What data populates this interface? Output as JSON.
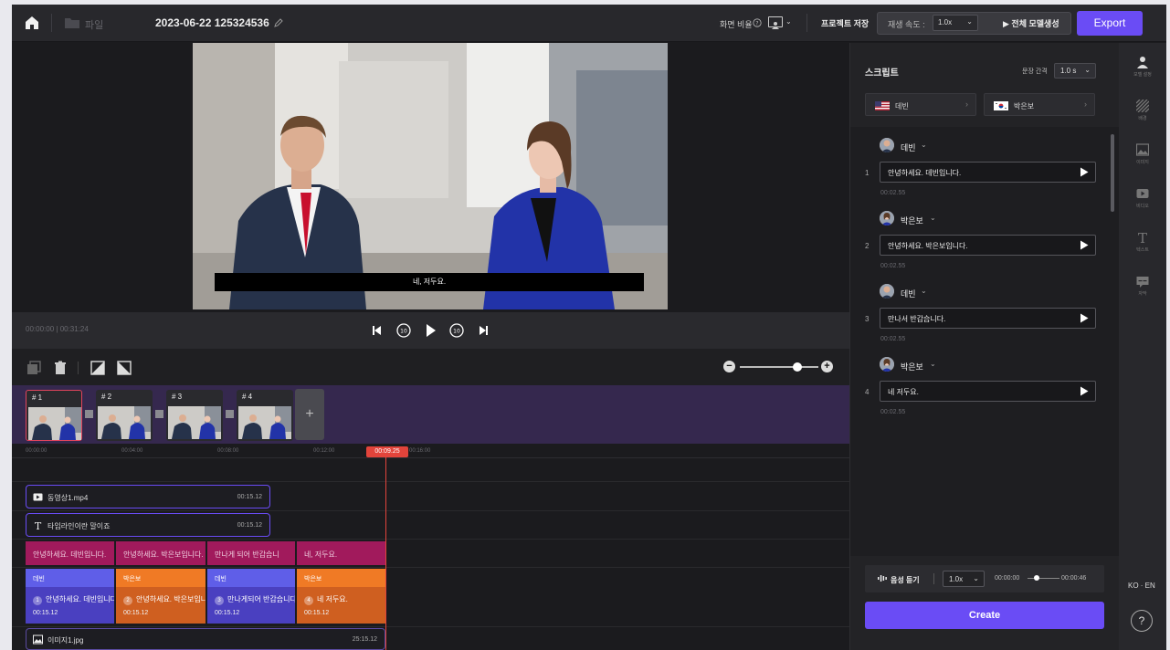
{
  "topbar": {
    "file_label": "파일",
    "project_title": "2023-06-22 125324536",
    "ratio_label": "화면 비율",
    "save_label": "프로젝트 저장",
    "speed_label": "재생 속도 :",
    "speed_value": "1.0x",
    "generate_all": "▶ 전체 모델생성",
    "export_label": "Export"
  },
  "preview": {
    "subtitle": "네, 저두요."
  },
  "playback": {
    "current_time": "00:00:00",
    "divider": "|",
    "total_time": "00:31:24"
  },
  "scenes": [
    {
      "label": "# 1"
    },
    {
      "label": "# 2"
    },
    {
      "label": "# 3"
    },
    {
      "label": "# 4"
    }
  ],
  "scene_add_label": "+",
  "ruler": {
    "ticks": [
      "00:00:00",
      "00:04:00",
      "00:08:00",
      "00:12:00",
      "00:16:00"
    ],
    "playhead": "00:09.25"
  },
  "tracks": {
    "video_clip": {
      "name": "동영상1.mp4",
      "duration": "00:15.12"
    },
    "text_clip": {
      "name": "타임라인이란 말이죠",
      "duration": "00:15.12"
    },
    "subtitles": [
      "안녕하세요. 데빈입니다.",
      "안녕하세요. 박은보입니다.",
      "만나게 되어 반갑습니",
      "네, 저두요."
    ],
    "speakers": [
      {
        "name": "데빈",
        "num": "1",
        "text": "안녕하세요. 데빈입니다.",
        "duration": "00:15.12"
      },
      {
        "name": "박은보",
        "num": "2",
        "text": "안녕하세요. 박은보입니다.",
        "duration": "00:15.12"
      },
      {
        "name": "데빈",
        "num": "3",
        "text": "만나게되어 반갑습니다.",
        "duration": "00:15.12"
      },
      {
        "name": "박은보",
        "num": "4",
        "text": "네 저두요.",
        "duration": "00:15.12"
      }
    ],
    "image_clip": {
      "name": "이미지1.jpg",
      "duration": "25:15.12"
    }
  },
  "script_panel": {
    "title": "스크립트",
    "gap_label": "문장 간격",
    "gap_value": "1.0 s",
    "speaker_tabs": [
      {
        "name": "데빈",
        "flag": "us"
      },
      {
        "name": "박은보",
        "flag": "kr"
      }
    ],
    "tab_arrow": "›",
    "entries": [
      {
        "index": "1",
        "speaker": "데빈",
        "text": "안녕하세요. 데빈입니다.",
        "time": "00:02.55"
      },
      {
        "index": "2",
        "speaker": "박은보",
        "text": "안녕하세요. 박은보입니다.",
        "time": "00:02.55"
      },
      {
        "index": "3",
        "speaker": "데빈",
        "text": "만나서 반갑습니다.",
        "time": "00:02.55"
      },
      {
        "index": "4",
        "speaker": "박은보",
        "text": "네 저두요.",
        "time": "00:02.55"
      }
    ],
    "audio_label": "음성 듣기",
    "audio_speed": "1.0x",
    "audio_start": "00:00:00",
    "audio_end": "00:00:46",
    "create_label": "Create"
  },
  "sidebar": {
    "items": [
      {
        "label": "모델 설정",
        "icon": "person-icon"
      },
      {
        "label": "배경",
        "icon": "background-icon"
      },
      {
        "label": "이미지",
        "icon": "image-icon"
      },
      {
        "label": "비디오",
        "icon": "video-icon"
      },
      {
        "label": "텍스트",
        "icon": "text-icon"
      },
      {
        "label": "자막",
        "icon": "subtitle-icon"
      }
    ],
    "lang_toggle": "KO · EN",
    "help_label": "?"
  },
  "colors": {
    "accent": "#6a4cf5",
    "playhead": "#e2443b",
    "subtitle_clip": "#a11a5c",
    "speaker_a": "#5f5ee8",
    "speaker_b": "#f07a25"
  }
}
